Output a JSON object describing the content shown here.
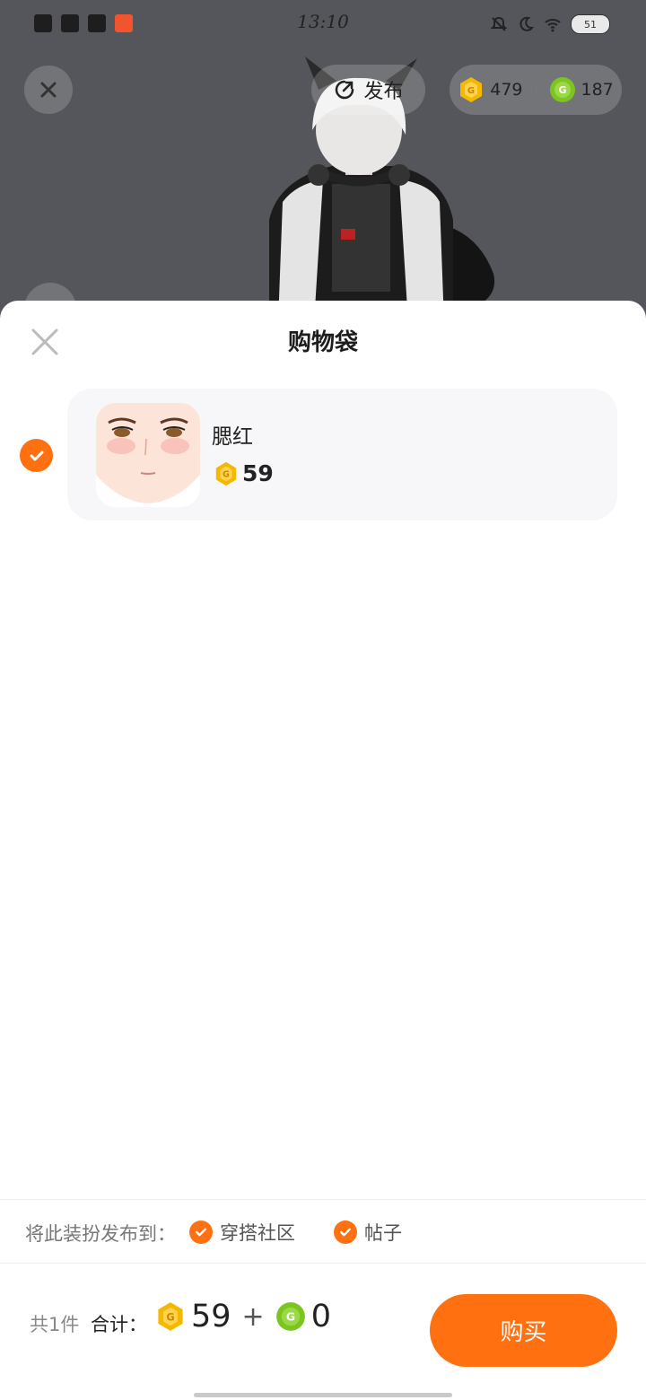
{
  "status_bar": {
    "time": "13:10",
    "battery": "51"
  },
  "top": {
    "publish_label": "发布",
    "coins_gold": "479",
    "coins_green": "187"
  },
  "sheet": {
    "title": "购物袋",
    "items": [
      {
        "name": "腮红",
        "price": "59",
        "selected": true
      }
    ]
  },
  "publish_to": {
    "label": "将此装扮发布到：",
    "options": [
      {
        "label": "穿搭社区",
        "checked": true
      },
      {
        "label": "帖子",
        "checked": true
      }
    ]
  },
  "checkout": {
    "count_text": "共1件",
    "total_label": "合计：",
    "gold_total": "59",
    "plus": "+",
    "green_total": "0",
    "buy_label": "购买"
  },
  "colors": {
    "accent": "#ff7010",
    "gold_coin": "#f5b800",
    "green_coin": "#7cc520",
    "dim_bg": "#55565b"
  }
}
